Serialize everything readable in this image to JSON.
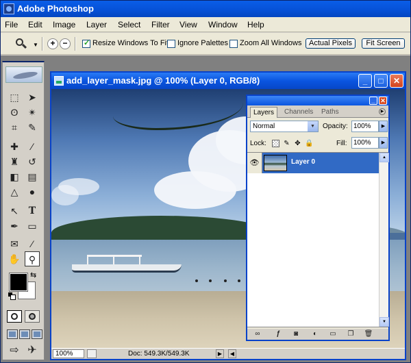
{
  "app": {
    "title": "Adobe Photoshop"
  },
  "menu": {
    "items": [
      "File",
      "Edit",
      "Image",
      "Layer",
      "Select",
      "Filter",
      "View",
      "Window",
      "Help"
    ]
  },
  "options_bar": {
    "resize_windows": {
      "label": "Resize Windows To Fit",
      "checked": true
    },
    "ignore_palettes": {
      "label": "Ignore Palettes",
      "checked": false
    },
    "zoom_all": {
      "label": "Zoom All Windows",
      "checked": false
    },
    "actual_pixels_label": "Actual Pixels",
    "fit_screen_label": "Fit Screen",
    "zoom_in_glyph": "+",
    "zoom_out_glyph": "−"
  },
  "toolbox": {
    "tools": [
      {
        "name": "marquee-tool-icon",
        "glyph": "⬚"
      },
      {
        "name": "move-tool-icon",
        "glyph": "➤"
      },
      {
        "name": "lasso-tool-icon",
        "glyph": "ʘ"
      },
      {
        "name": "magic-wand-tool-icon",
        "glyph": "✴"
      },
      {
        "name": "crop-tool-icon",
        "glyph": "⌗"
      },
      {
        "name": "slice-tool-icon",
        "glyph": "✎"
      },
      {
        "name": "healing-brush-tool-icon",
        "glyph": "✚"
      },
      {
        "name": "brush-tool-icon",
        "glyph": "∕"
      },
      {
        "name": "clone-stamp-tool-icon",
        "glyph": "♜"
      },
      {
        "name": "history-brush-tool-icon",
        "glyph": "↺"
      },
      {
        "name": "eraser-tool-icon",
        "glyph": "◧"
      },
      {
        "name": "gradient-tool-icon",
        "glyph": "▤"
      },
      {
        "name": "blur-tool-icon",
        "glyph": "△"
      },
      {
        "name": "dodge-tool-icon",
        "glyph": "●"
      },
      {
        "name": "path-selection-tool-icon",
        "glyph": "↖"
      },
      {
        "name": "type-tool-icon",
        "glyph": "T"
      },
      {
        "name": "pen-tool-icon",
        "glyph": "✒"
      },
      {
        "name": "shape-tool-icon",
        "glyph": "▭"
      },
      {
        "name": "notes-tool-icon",
        "glyph": "✉"
      },
      {
        "name": "eyedropper-tool-icon",
        "glyph": "⁄"
      },
      {
        "name": "hand-tool-icon",
        "glyph": "✋"
      },
      {
        "name": "zoom-tool-icon",
        "glyph": "⚲"
      }
    ],
    "foreground_color": "#000000",
    "background_color": "#ffffff"
  },
  "document": {
    "title": "add_layer_mask.jpg @ 100% (Layer 0, RGB/8)",
    "minimize_glyph": "_",
    "maximize_glyph": "□",
    "close_glyph": "✕",
    "zoom_value": "100%",
    "doc_info": "Doc: 549.3K/549.3K"
  },
  "layers_palette": {
    "tabs": [
      "Layers",
      "Channels",
      "Paths"
    ],
    "active_tab": "Layers",
    "blend_mode": "Normal",
    "opacity_label": "Opacity:",
    "opacity_value": "100%",
    "lock_label": "Lock:",
    "fill_label": "Fill:",
    "fill_value": "100%",
    "layers": [
      {
        "name": "Layer 0",
        "visible": true,
        "selected": true
      }
    ]
  }
}
